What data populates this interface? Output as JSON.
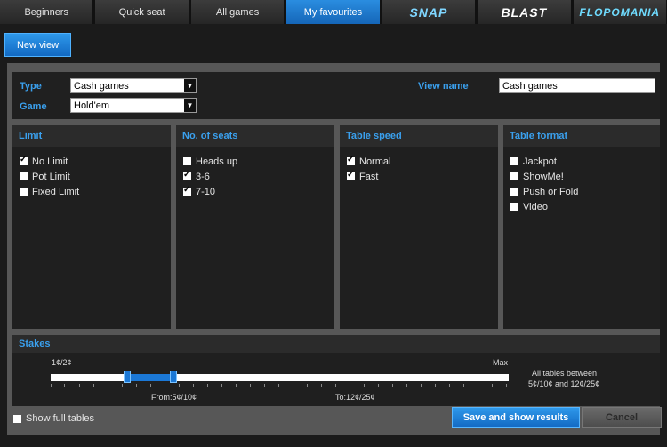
{
  "tabs": [
    "Beginners",
    "Quick seat",
    "All games",
    "My favourites",
    "SNAP",
    "BLAST",
    "FLOPOMANIA"
  ],
  "new_view_label": "New view",
  "filters": {
    "type_label": "Type",
    "type_value": "Cash games",
    "game_label": "Game",
    "game_value": "Hold'em",
    "view_name_label": "View name",
    "view_name_value": "Cash games"
  },
  "columns": [
    {
      "title": "Limit",
      "options": [
        {
          "label": "No Limit",
          "checked": true
        },
        {
          "label": "Pot Limit",
          "checked": false
        },
        {
          "label": "Fixed Limit",
          "checked": false
        }
      ]
    },
    {
      "title": "No. of seats",
      "options": [
        {
          "label": "Heads up",
          "checked": false
        },
        {
          "label": "3-6",
          "checked": true
        },
        {
          "label": "7-10",
          "checked": true
        }
      ]
    },
    {
      "title": "Table speed",
      "options": [
        {
          "label": "Normal",
          "checked": true
        },
        {
          "label": "Fast",
          "checked": true
        }
      ]
    },
    {
      "title": "Table format",
      "options": [
        {
          "label": "Jackpot",
          "checked": false
        },
        {
          "label": "ShowMe!",
          "checked": false
        },
        {
          "label": "Push or Fold",
          "checked": false
        },
        {
          "label": "Video",
          "checked": false
        }
      ]
    }
  ],
  "stakes": {
    "title": "Stakes",
    "min_label": "1¢/2¢",
    "max_label": "Max",
    "from_label": "From:5¢/10¢",
    "to_label": "To:12¢/25¢",
    "summary_line1": "All tables between",
    "summary_line2": "5¢/10¢ and 12¢/25¢"
  },
  "show_full_tables_label": "Show full tables",
  "show_full_tables_checked": false,
  "save_label": "Save and show results",
  "cancel_label": "Cancel",
  "icons": {
    "dropdown": "chevron-down-icon",
    "checkbox": "checkbox-icon"
  }
}
